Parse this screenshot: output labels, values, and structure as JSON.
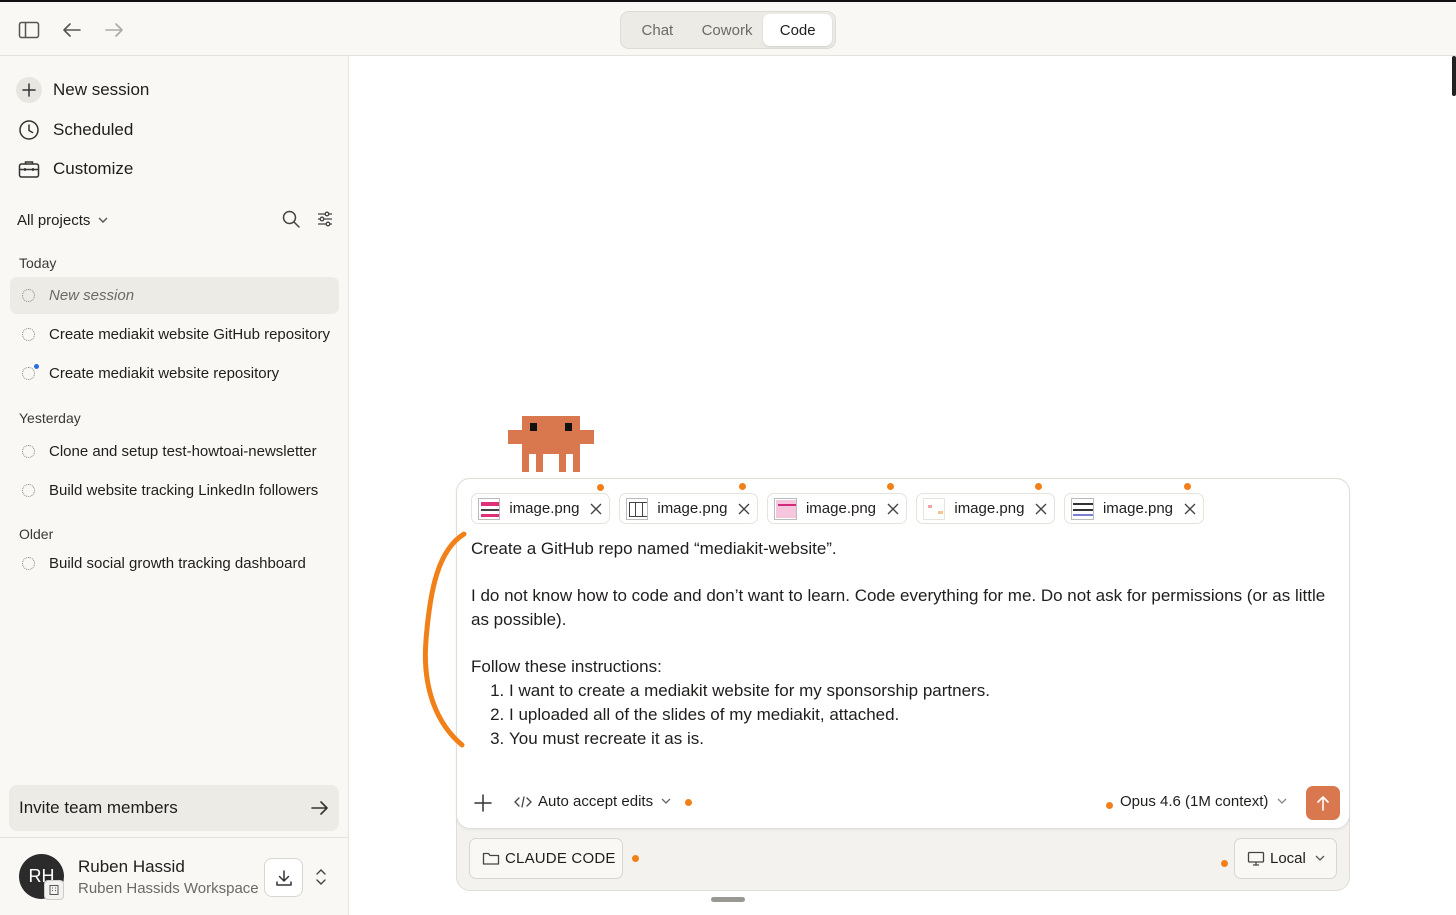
{
  "window": {
    "tabs": [
      {
        "label": "Chat",
        "active": false
      },
      {
        "label": "Cowork",
        "active": false
      },
      {
        "label": "Code",
        "active": true
      }
    ]
  },
  "sidebar": {
    "nav": [
      {
        "label": "New session",
        "icon": "plus-icon"
      },
      {
        "label": "Scheduled",
        "icon": "clock-icon"
      },
      {
        "label": "Customize",
        "icon": "briefcase-icon"
      }
    ],
    "projects_label": "All projects",
    "sections": [
      {
        "label": "Today",
        "sessions": [
          "New session",
          "Create mediakit website GitHub repository",
          "Create mediakit website repository"
        ]
      },
      {
        "label": "Yesterday",
        "sessions": [
          "Clone and setup test-howtoai-newsletter",
          "Build website tracking LinkedIn followers"
        ]
      },
      {
        "label": "Older",
        "sessions": [
          "Build social growth tracking dashboard"
        ]
      }
    ],
    "invite_label": "Invite team members",
    "user": {
      "initials": "RH",
      "name": "Ruben Hassid",
      "org": "Ruben Hassids Workspace"
    }
  },
  "composer": {
    "attachments": [
      "image.png",
      "image.png",
      "image.png",
      "image.png",
      "image.png"
    ],
    "prompt": {
      "line1": "Create a GitHub repo named “mediakit-website”.",
      "line2": "I do not know how to code and don’t want to learn. Code everything for me. Do not ask for permissions (or as little as possible).",
      "line3": "Follow these instructions:",
      "steps": [
        "I want to create a mediakit website for my sponsorship partners.",
        "I uploaded all of the slides of my mediakit, attached.",
        "You must recreate it as is."
      ]
    },
    "mode_label": "Auto accept edits",
    "model_label": "Opus 4.6 (1M context)",
    "project_button": "CLAUDE CODE",
    "env_button": "Local"
  },
  "colors": {
    "accent": "#d9774f",
    "annotation": "#f28018",
    "mascot": "#d9774f"
  }
}
